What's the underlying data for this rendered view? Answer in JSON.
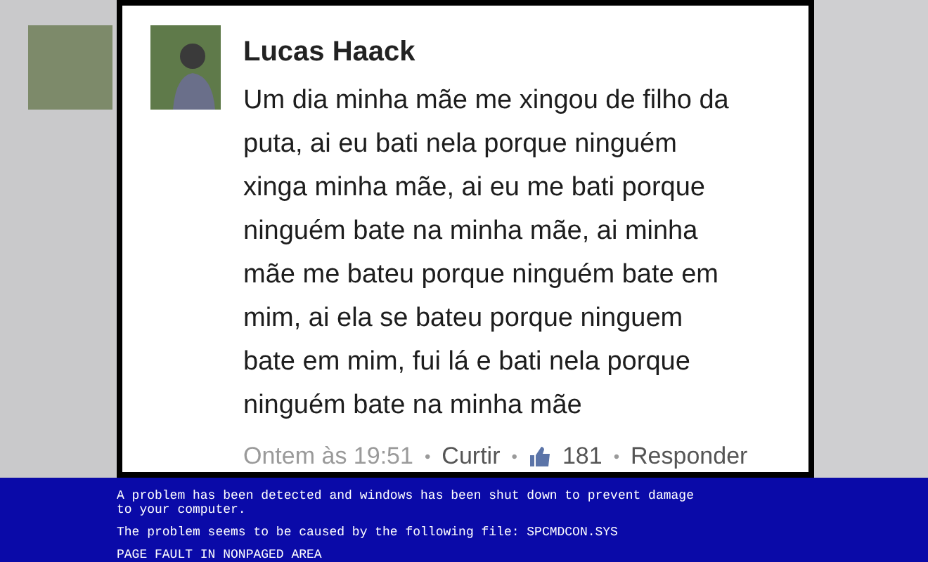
{
  "comment": {
    "author": "Lucas Haack",
    "message": "Um dia minha mãe me xingou de filho da puta, ai eu bati nela porque ninguém xinga minha mãe, ai eu me bati porque ninguém bate na minha mãe, ai minha mãe me bateu porque ninguém bate em mim, ai ela se bateu porque ninguem bate em mim, fui lá e bati nela porque ninguém bate na minha mãe",
    "time": "Ontem às 19:51",
    "like_action": "Curtir",
    "like_count": "181",
    "reply_action": "Responder",
    "separator": "•"
  },
  "error_screen": {
    "lines": [
      "A problem has been detected and windows has been shut down to prevent damage",
      "to your computer.",
      "The problem seems to be caused by the following file: SPCMDCON.SYS",
      "PAGE FAULT IN NONPAGED AREA"
    ]
  }
}
